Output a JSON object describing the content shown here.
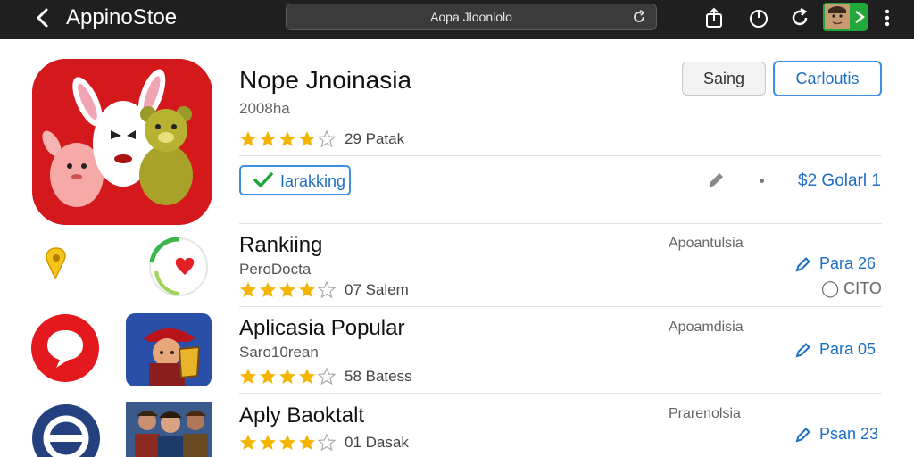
{
  "topbar": {
    "back_icon": "chevron-left-icon",
    "app_title": "AppinoStoe",
    "search_text": "Aopa Jloonlolo",
    "icons": [
      "reload-icon",
      "share-icon",
      "power-icon",
      "refresh-icon",
      "user-avatar",
      "more-vertical-icon"
    ]
  },
  "hero": {
    "name": "Nope Jnoinasia",
    "subtitle": "2008ha",
    "rating_text": "29 Patak",
    "stars": 4.5,
    "sharing_label": "Saing",
    "get_label": "Carloutis",
    "badge_label": "Iarakking",
    "price": "$2 Golarl 1"
  },
  "rows": [
    {
      "name": "Rankiing",
      "subtitle": "PeroDocta",
      "rating_text": "07 Salem",
      "stars": 4.5,
      "category": "Apoantulsia",
      "price": "Para 26",
      "extra": "CITO"
    },
    {
      "name": "Aplicasia Popular",
      "subtitle": "Saro10rean",
      "rating_text": "58 Batess",
      "stars": 4.5,
      "category": "Apoamdisia",
      "price": "Para 05"
    },
    {
      "name": "Aply Baoktalt",
      "subtitle": "",
      "rating_text": "01 Dasak",
      "stars": 4.5,
      "category": "Prarenolsia",
      "price": "Psan 23"
    }
  ],
  "colors": {
    "accent": "#1e6fc4",
    "star": "#f4b400",
    "topbar": "#1f1f1f",
    "hero_icon": "#d4191d"
  }
}
